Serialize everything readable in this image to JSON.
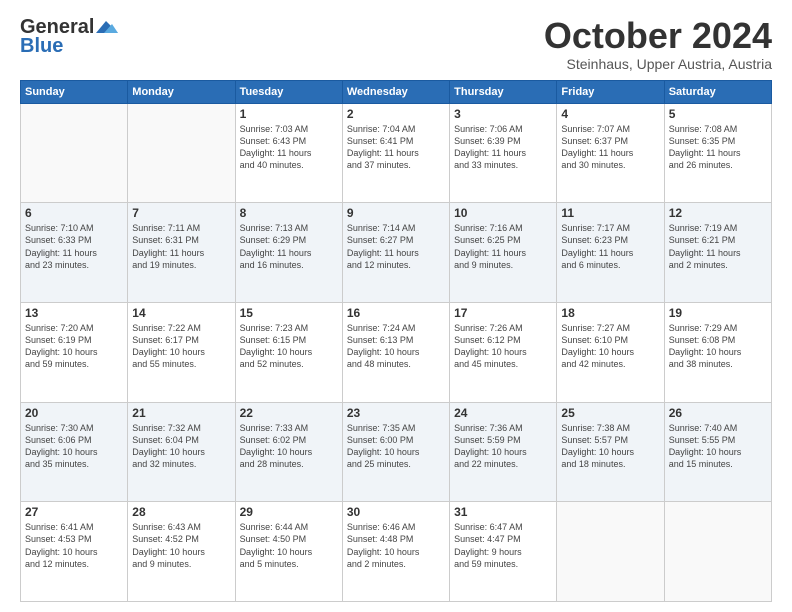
{
  "header": {
    "logo_line1": "General",
    "logo_line2": "Blue",
    "month": "October 2024",
    "location": "Steinhaus, Upper Austria, Austria"
  },
  "weekdays": [
    "Sunday",
    "Monday",
    "Tuesday",
    "Wednesday",
    "Thursday",
    "Friday",
    "Saturday"
  ],
  "weeks": [
    [
      {
        "day": "",
        "info": ""
      },
      {
        "day": "",
        "info": ""
      },
      {
        "day": "1",
        "info": "Sunrise: 7:03 AM\nSunset: 6:43 PM\nDaylight: 11 hours\nand 40 minutes."
      },
      {
        "day": "2",
        "info": "Sunrise: 7:04 AM\nSunset: 6:41 PM\nDaylight: 11 hours\nand 37 minutes."
      },
      {
        "day": "3",
        "info": "Sunrise: 7:06 AM\nSunset: 6:39 PM\nDaylight: 11 hours\nand 33 minutes."
      },
      {
        "day": "4",
        "info": "Sunrise: 7:07 AM\nSunset: 6:37 PM\nDaylight: 11 hours\nand 30 minutes."
      },
      {
        "day": "5",
        "info": "Sunrise: 7:08 AM\nSunset: 6:35 PM\nDaylight: 11 hours\nand 26 minutes."
      }
    ],
    [
      {
        "day": "6",
        "info": "Sunrise: 7:10 AM\nSunset: 6:33 PM\nDaylight: 11 hours\nand 23 minutes."
      },
      {
        "day": "7",
        "info": "Sunrise: 7:11 AM\nSunset: 6:31 PM\nDaylight: 11 hours\nand 19 minutes."
      },
      {
        "day": "8",
        "info": "Sunrise: 7:13 AM\nSunset: 6:29 PM\nDaylight: 11 hours\nand 16 minutes."
      },
      {
        "day": "9",
        "info": "Sunrise: 7:14 AM\nSunset: 6:27 PM\nDaylight: 11 hours\nand 12 minutes."
      },
      {
        "day": "10",
        "info": "Sunrise: 7:16 AM\nSunset: 6:25 PM\nDaylight: 11 hours\nand 9 minutes."
      },
      {
        "day": "11",
        "info": "Sunrise: 7:17 AM\nSunset: 6:23 PM\nDaylight: 11 hours\nand 6 minutes."
      },
      {
        "day": "12",
        "info": "Sunrise: 7:19 AM\nSunset: 6:21 PM\nDaylight: 11 hours\nand 2 minutes."
      }
    ],
    [
      {
        "day": "13",
        "info": "Sunrise: 7:20 AM\nSunset: 6:19 PM\nDaylight: 10 hours\nand 59 minutes."
      },
      {
        "day": "14",
        "info": "Sunrise: 7:22 AM\nSunset: 6:17 PM\nDaylight: 10 hours\nand 55 minutes."
      },
      {
        "day": "15",
        "info": "Sunrise: 7:23 AM\nSunset: 6:15 PM\nDaylight: 10 hours\nand 52 minutes."
      },
      {
        "day": "16",
        "info": "Sunrise: 7:24 AM\nSunset: 6:13 PM\nDaylight: 10 hours\nand 48 minutes."
      },
      {
        "day": "17",
        "info": "Sunrise: 7:26 AM\nSunset: 6:12 PM\nDaylight: 10 hours\nand 45 minutes."
      },
      {
        "day": "18",
        "info": "Sunrise: 7:27 AM\nSunset: 6:10 PM\nDaylight: 10 hours\nand 42 minutes."
      },
      {
        "day": "19",
        "info": "Sunrise: 7:29 AM\nSunset: 6:08 PM\nDaylight: 10 hours\nand 38 minutes."
      }
    ],
    [
      {
        "day": "20",
        "info": "Sunrise: 7:30 AM\nSunset: 6:06 PM\nDaylight: 10 hours\nand 35 minutes."
      },
      {
        "day": "21",
        "info": "Sunrise: 7:32 AM\nSunset: 6:04 PM\nDaylight: 10 hours\nand 32 minutes."
      },
      {
        "day": "22",
        "info": "Sunrise: 7:33 AM\nSunset: 6:02 PM\nDaylight: 10 hours\nand 28 minutes."
      },
      {
        "day": "23",
        "info": "Sunrise: 7:35 AM\nSunset: 6:00 PM\nDaylight: 10 hours\nand 25 minutes."
      },
      {
        "day": "24",
        "info": "Sunrise: 7:36 AM\nSunset: 5:59 PM\nDaylight: 10 hours\nand 22 minutes."
      },
      {
        "day": "25",
        "info": "Sunrise: 7:38 AM\nSunset: 5:57 PM\nDaylight: 10 hours\nand 18 minutes."
      },
      {
        "day": "26",
        "info": "Sunrise: 7:40 AM\nSunset: 5:55 PM\nDaylight: 10 hours\nand 15 minutes."
      }
    ],
    [
      {
        "day": "27",
        "info": "Sunrise: 6:41 AM\nSunset: 4:53 PM\nDaylight: 10 hours\nand 12 minutes."
      },
      {
        "day": "28",
        "info": "Sunrise: 6:43 AM\nSunset: 4:52 PM\nDaylight: 10 hours\nand 9 minutes."
      },
      {
        "day": "29",
        "info": "Sunrise: 6:44 AM\nSunset: 4:50 PM\nDaylight: 10 hours\nand 5 minutes."
      },
      {
        "day": "30",
        "info": "Sunrise: 6:46 AM\nSunset: 4:48 PM\nDaylight: 10 hours\nand 2 minutes."
      },
      {
        "day": "31",
        "info": "Sunrise: 6:47 AM\nSunset: 4:47 PM\nDaylight: 9 hours\nand 59 minutes."
      },
      {
        "day": "",
        "info": ""
      },
      {
        "day": "",
        "info": ""
      }
    ]
  ]
}
